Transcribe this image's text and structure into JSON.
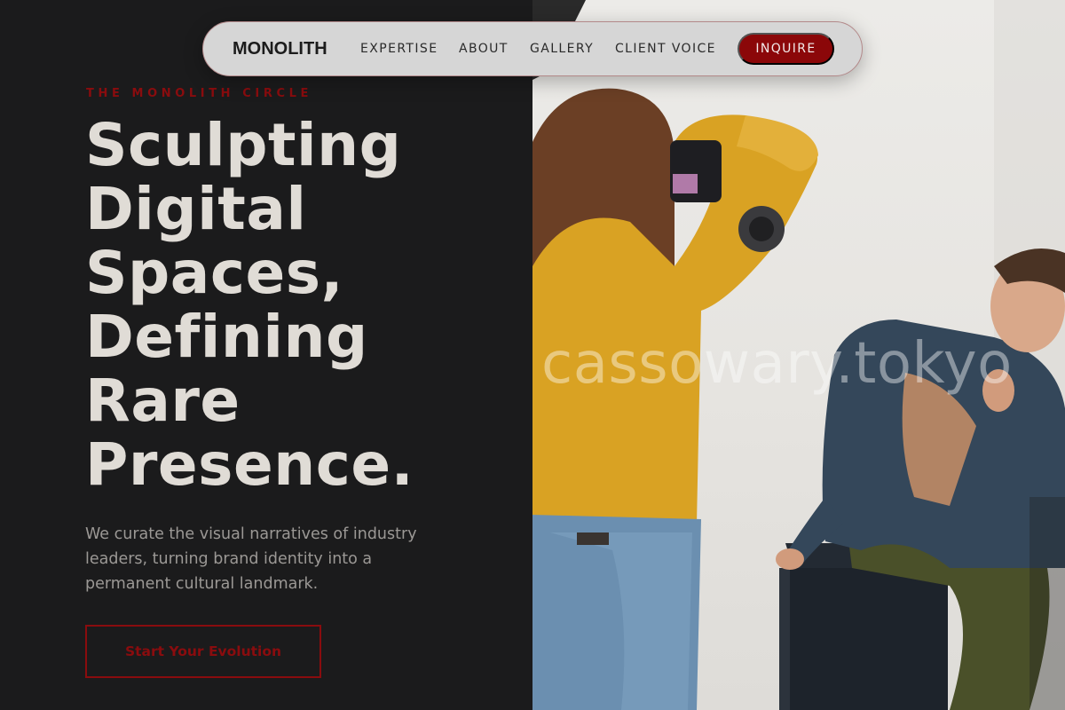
{
  "nav": {
    "brand": "MONOLITH",
    "links": [
      "EXPERTISE",
      "ABOUT",
      "GALLERY",
      "CLIENT VOICE"
    ],
    "cta_label": "INQUIRE"
  },
  "hero": {
    "eyebrow": "THE MONOLITH CIRCLE",
    "headline_lines": [
      "Sculpting",
      "Digital",
      "Spaces,",
      "Defining",
      "Rare",
      "Presence."
    ],
    "lede": "We curate the visual narratives of industry leaders, turning brand identity into a permanent cultural landmark.",
    "cta_label": "Start Your Evolution"
  },
  "photo": {
    "watermark": "cassowary.tokyo"
  },
  "colors": {
    "accent": "#8b0709",
    "panel_bg": "#1b1b1c",
    "headline": "#e0dcd6",
    "body_text": "#9b9895",
    "nav_bg": "#d6d6d6"
  }
}
